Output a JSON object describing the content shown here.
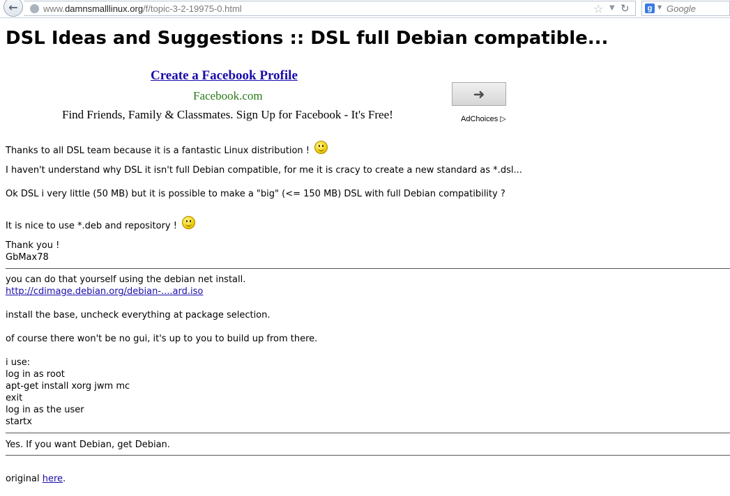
{
  "browser": {
    "url_prefix": "www.",
    "url_domain": "damnsmalllinux.org",
    "url_path": "/f/topic-3-2-19975-0.html",
    "search_placeholder": "Google",
    "search_engine_icon": "google-icon"
  },
  "page": {
    "title": "DSL Ideas and Suggestions :: DSL full Debian compatible..."
  },
  "ad": {
    "headline": "Create a Facebook Profile",
    "display_url": "Facebook.com",
    "description": "Find Friends, Family & Classmates. Sign Up for Facebook - It's Free!",
    "arrow_icon": "arrow-right-icon",
    "adchoices_label": "AdChoices",
    "adchoices_glyph": "▷"
  },
  "post1": {
    "line1": "Thanks to all DSL team because it is a fantastic Linux distribution !",
    "line2": "I haven't understand why DSL it isn't full Debian compatible, for me it is cracy to create a new standard as *.dsl...",
    "line3": "Ok DSL i very little (50 MB) but it is possible to make a \"big\" (<= 150 MB) DSL with full Debian compatibility ?",
    "line4": "It is nice to use *.deb and repository !",
    "line5": "Thank you !",
    "signature": "GbMax78"
  },
  "post2": {
    "line1": "you can do that yourself using the debian net install.",
    "link": "http://cdimage.debian.org/debian-....ard.iso",
    "line2": "install the base, uncheck everything at package selection.",
    "line3": "of course there won't be no gui, it's up to you to build up from there.",
    "line4": "i use:",
    "cmd1": "log in as root",
    "cmd2": "apt-get install xorg jwm mc",
    "cmd3": "exit",
    "cmd4": "log in as the user",
    "cmd5": "startx"
  },
  "post3": {
    "line1": "Yes. If you want Debian, get Debian."
  },
  "footer": {
    "prefix": "original ",
    "link": "here",
    "suffix": "."
  }
}
